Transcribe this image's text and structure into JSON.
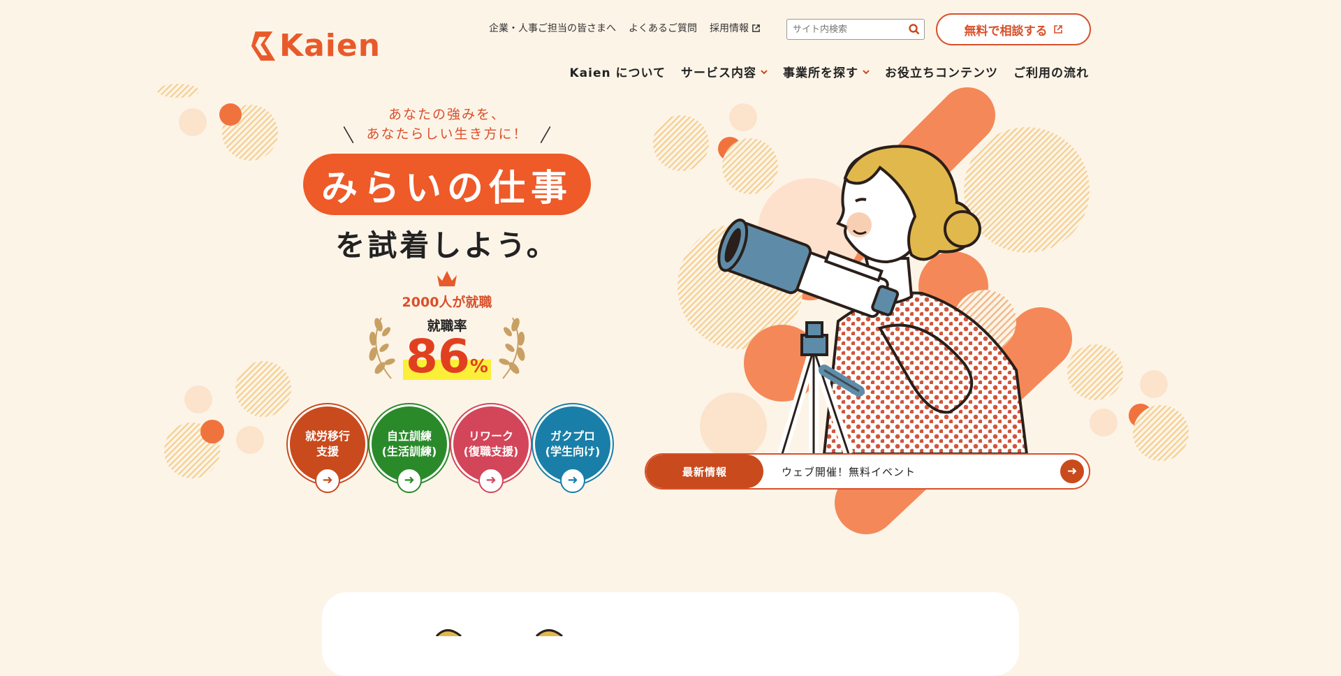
{
  "brand": {
    "name": "Kaien",
    "accent": "#e85a2a",
    "dark_accent": "#c94a1c"
  },
  "header": {
    "top_links": [
      {
        "label": "企業・人事ご担当の皆さまへ",
        "external": false
      },
      {
        "label": "よくあるご質問",
        "external": false
      },
      {
        "label": "採用情報",
        "external": true
      }
    ],
    "search": {
      "placeholder": "サイト内検索",
      "icon": "search-icon"
    },
    "consult_button": "無料で相談する",
    "nav": [
      {
        "label": "Kaien について",
        "dropdown": false
      },
      {
        "label": "サービス内容",
        "dropdown": true
      },
      {
        "label": "事業所を探す",
        "dropdown": true
      },
      {
        "label": "お役立ちコンテンツ",
        "dropdown": false
      },
      {
        "label": "ご利用の流れ",
        "dropdown": false
      }
    ]
  },
  "hero": {
    "tagline_1": "あなたの強みを、",
    "tagline_2": "あなたらしい生き方に！",
    "headline": "みらいの仕事",
    "subheadline": "を試着しよう。",
    "award": {
      "line1": "2000人が就職",
      "line2": "就職率",
      "rate": "86",
      "unit": "%"
    },
    "services": [
      {
        "line1": "就労移行",
        "line2": "支援",
        "color": "#c94a1c"
      },
      {
        "line1": "自立訓練",
        "line2": "(生活訓練)",
        "color": "#2a8a2a"
      },
      {
        "line1": "リワーク",
        "line2": "(復職支援)",
        "color": "#d3465a"
      },
      {
        "line1": "ガクプロ",
        "line2": "(学生向け)",
        "color": "#1a7fa8"
      }
    ]
  },
  "news": {
    "label": "最新情報",
    "text": "ウェブ開催！無料イベント"
  }
}
